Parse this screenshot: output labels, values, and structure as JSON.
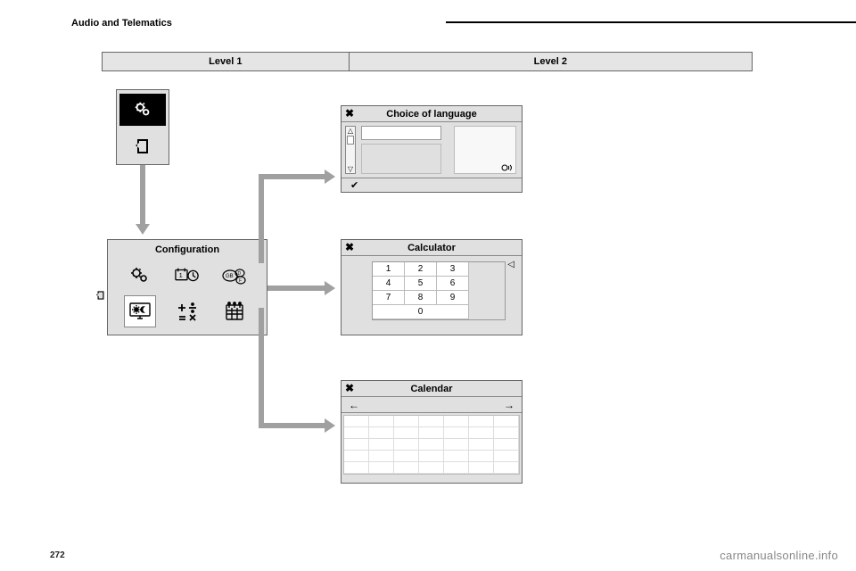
{
  "header": "Audio and Telematics",
  "page_number": "272",
  "watermark": "carmanualsonline.info",
  "levels": {
    "l1": "Level 1",
    "l2": "Level 2"
  },
  "config": {
    "title": "Configuration",
    "icons": [
      "gears-icon",
      "date-time-icon",
      "language-gbdf-icon",
      "brightness-icon",
      "calculator-icon",
      "calendar-icon"
    ]
  },
  "language_panel": {
    "close": "✖",
    "title": "Choice of language",
    "ok": "✔"
  },
  "calculator_panel": {
    "close": "✖",
    "title": "Calculator",
    "clear": "◁",
    "keys": [
      "1",
      "2",
      "3",
      "4",
      "5",
      "6",
      "7",
      "8",
      "9",
      "0"
    ]
  },
  "calendar_panel": {
    "close": "✖",
    "title": "Calendar",
    "prev": "←",
    "next": "→"
  }
}
